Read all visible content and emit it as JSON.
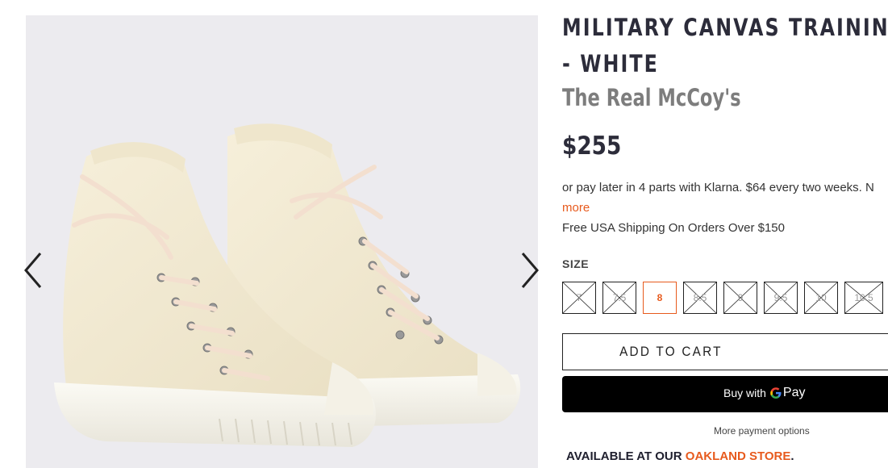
{
  "product": {
    "title_line1": "MILITARY CANVAS TRAINING S",
    "title_line2": "- WHITE",
    "vendor": "The Real McCoy's",
    "price": "$255"
  },
  "klarna": {
    "text": "or pay later in 4 parts with Klarna. $64 every two weeks. N",
    "more_link": "more"
  },
  "shipping": {
    "text": "Free USA Shipping On Orders Over $150"
  },
  "size": {
    "label": "SIZE",
    "options": [
      {
        "label": "7",
        "available": false,
        "selected": false
      },
      {
        "label": "7.5",
        "available": false,
        "selected": false
      },
      {
        "label": "8",
        "available": true,
        "selected": true
      },
      {
        "label": "8.5",
        "available": false,
        "selected": false
      },
      {
        "label": "9",
        "available": false,
        "selected": false
      },
      {
        "label": "9.5",
        "available": false,
        "selected": false
      },
      {
        "label": "10",
        "available": false,
        "selected": false
      },
      {
        "label": "10.5",
        "available": false,
        "selected": false
      }
    ]
  },
  "buttons": {
    "add_to_cart": "ADD TO CART",
    "gpay_buy": "Buy with",
    "gpay_pay": "Pay",
    "more_payment": "More payment options"
  },
  "availability": {
    "prefix": "AVAILABLE AT OUR",
    "store": "OAKLAND STORE",
    "suffix": "."
  },
  "gallery": {
    "image_name": "white-high-top-canvas-sneakers",
    "prev_icon": "chevron-left-icon",
    "next_icon": "chevron-right-icon"
  },
  "colors": {
    "accent": "#e75a1d",
    "text_dark": "#2c2c3a",
    "vendor_gray": "#7d7d7d",
    "gallery_bg": "#ecebef",
    "gpay_bg": "#000000"
  }
}
